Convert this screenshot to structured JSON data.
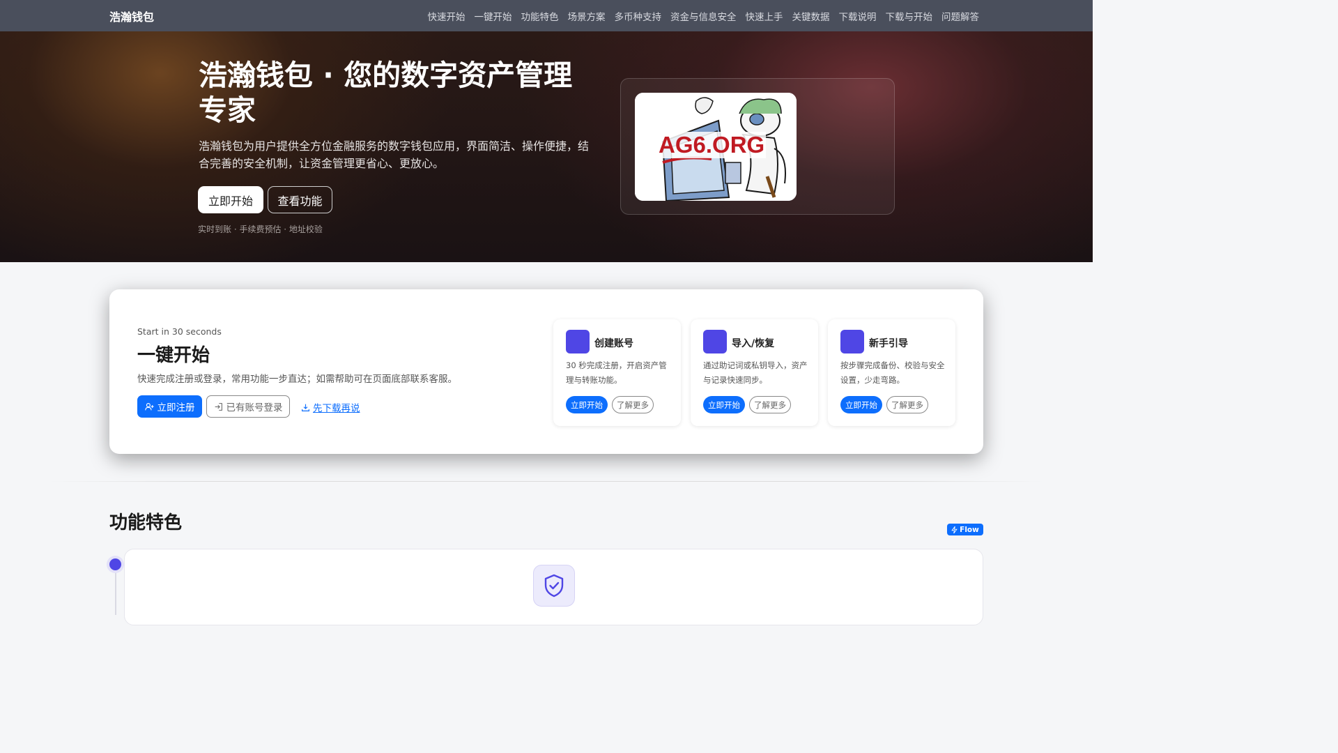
{
  "nav": {
    "brand": "浩瀚钱包",
    "links": [
      "快速开始",
      "一键开始",
      "功能特色",
      "场景方案",
      "多币种支持",
      "资金与信息安全",
      "快速上手",
      "关键数据",
      "下载说明",
      "下载与开始",
      "问题解答"
    ]
  },
  "hero": {
    "title": "浩瀚钱包 · 您的数字资产管理专家",
    "description": "浩瀚钱包为用户提供全方位金融服务的数字钱包应用，界面简洁、操作便捷，结合完善的安全机制，让资金管理更省心、更放心。",
    "primary_button": "立即开始",
    "secondary_button": "查看功能",
    "tags": "实时到账 · 手续费预估 · 地址校验",
    "logo_text": "AG6.ORG"
  },
  "quick_start": {
    "eyebrow": "Start in 30 seconds",
    "title": "一键开始",
    "description": "快速完成注册或登录，常用功能一步直达；如需帮助可在页面底部联系客服。",
    "register_button": "立即注册",
    "login_button": "已有账号登录",
    "download_link": "先下载再说",
    "cards": [
      {
        "title": "创建账号",
        "description": "30 秒完成注册，开启资产管理与转账功能。",
        "primary": "立即开始",
        "secondary": "了解更多"
      },
      {
        "title": "导入/恢复",
        "description": "通过助记词或私钥导入，资产与记录快速同步。",
        "primary": "立即开始",
        "secondary": "了解更多"
      },
      {
        "title": "新手引导",
        "description": "按步骤完成备份、校验与安全设置，少走弯路。",
        "primary": "立即开始",
        "secondary": "了解更多"
      }
    ]
  },
  "features": {
    "title": "功能特色",
    "badge": "Flow"
  },
  "colors": {
    "accent": "#0d6efd",
    "indigo": "#4f46e5",
    "nav_bg": "#4a4f5c"
  }
}
